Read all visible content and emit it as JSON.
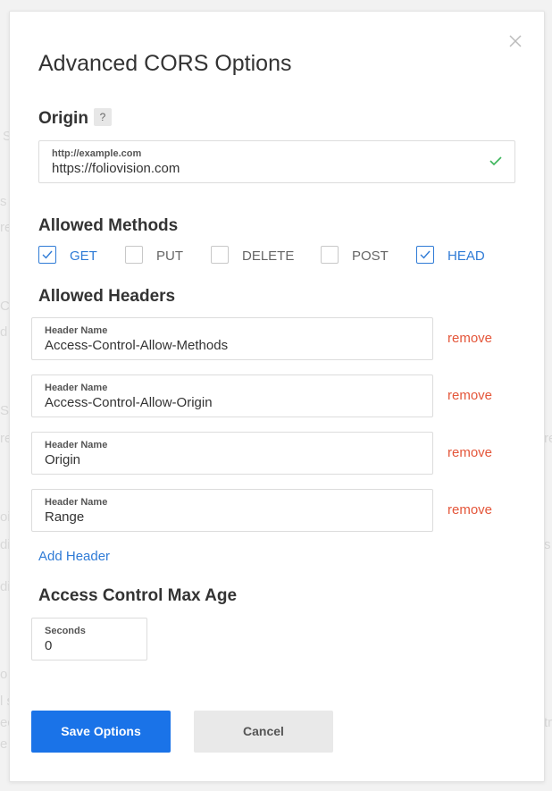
{
  "background": {
    "fragments": [
      "S",
      "s",
      "re",
      "C",
      "d",
      "S",
      "re",
      "oi",
      "di",
      "di",
      "o",
      "l s",
      "ec",
      "e",
      "re",
      "s",
      "tr"
    ]
  },
  "modal": {
    "title": "Advanced CORS Options",
    "close_icon": "close-icon",
    "origin": {
      "heading": "Origin",
      "help": "?",
      "field_label": "http://example.com",
      "field_value": "https://foliovision.com",
      "valid_icon": "checkmark-icon"
    },
    "methods": {
      "heading": "Allowed Methods",
      "items": [
        {
          "label": "GET",
          "checked": true
        },
        {
          "label": "PUT",
          "checked": false
        },
        {
          "label": "DELETE",
          "checked": false
        },
        {
          "label": "POST",
          "checked": false
        },
        {
          "label": "HEAD",
          "checked": true
        }
      ]
    },
    "headers": {
      "heading": "Allowed Headers",
      "field_label": "Header Name",
      "remove_label": "remove",
      "items": [
        {
          "label": "Header Name",
          "value": "Access-Control-Allow-Methods"
        },
        {
          "label": "Header Name",
          "value": "Access-Control-Allow-Origin"
        },
        {
          "label": "Header Name",
          "value": "Origin"
        },
        {
          "label": "Header Name",
          "value": "Range"
        }
      ],
      "add_label": "Add Header"
    },
    "max_age": {
      "heading": "Access Control Max Age",
      "field_label": "Seconds",
      "field_value": "0"
    },
    "buttons": {
      "save": "Save Options",
      "cancel": "Cancel"
    }
  },
  "colors": {
    "accent": "#2f7bd6",
    "primary_button": "#1a73e8",
    "remove": "#e4563a",
    "valid": "#3bb55a"
  }
}
